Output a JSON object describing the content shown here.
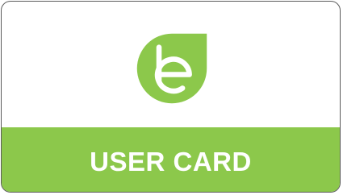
{
  "card": {
    "title": "USER CARD",
    "accent_color": "#8cc84b",
    "logo_icon": "leaf-e-logo-icon"
  }
}
